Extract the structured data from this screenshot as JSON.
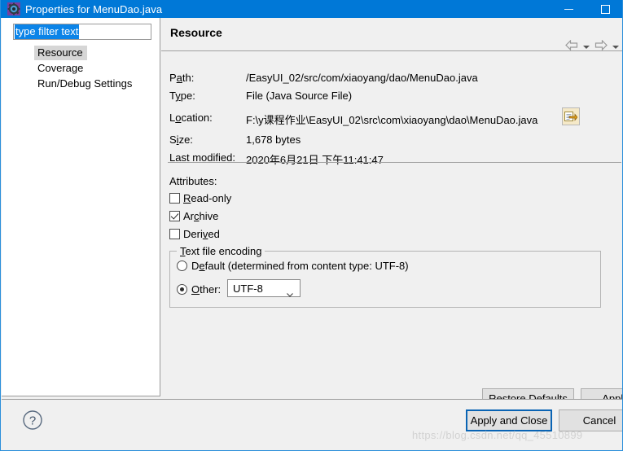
{
  "window": {
    "title": "Properties for MenuDao.java",
    "icon": "properties-gear-icon",
    "accent_color": "#0078d7",
    "minimize_label": "Minimize",
    "maximize_label": "Maximize"
  },
  "sidebar": {
    "filter": {
      "value": "type filter text",
      "placeholder": "type filter text",
      "selection_color": "#0b84e8"
    },
    "items": [
      {
        "label": "Resource",
        "selected": true
      },
      {
        "label": "Coverage",
        "selected": false
      },
      {
        "label": "Run/Debug Settings",
        "selected": false
      }
    ]
  },
  "nav": {
    "back_icon": "arrow-left-icon",
    "back_menu_icon": "chevron-down-icon",
    "forward_icon": "arrow-right-icon",
    "forward_menu_icon": "chevron-down-icon"
  },
  "page": {
    "heading": "Resource",
    "properties": [
      {
        "label_pre": "P",
        "label_mn": "a",
        "label_post": "th:",
        "value": "/EasyUI_02/src/com/xiaoyang/dao/MenuDao.java",
        "name": "path"
      },
      {
        "label_pre": "T",
        "label_mn": "y",
        "label_post": "pe:",
        "value": "File   (Java Source File)",
        "name": "type"
      },
      {
        "label_pre": "L",
        "label_mn": "o",
        "label_post": "cation:",
        "value": "F:\\y课程作业\\EasyUI_02\\src\\com\\xiaoyang\\dao\\MenuDao.java",
        "name": "location"
      },
      {
        "label_pre": "S",
        "label_mn": "i",
        "label_post": "ze:",
        "value": "1,678   bytes",
        "name": "size"
      },
      {
        "label_pre": "Last ",
        "label_mn": "m",
        "label_post": "odified:",
        "value": "2020年6月21日 下午11:41:47",
        "name": "last-modified"
      }
    ],
    "location_button_icon": "open-external-editor-icon",
    "attributes": {
      "label": "Attributes:",
      "items": [
        {
          "pre": "",
          "mn": "R",
          "post": "ead-only",
          "checked": false,
          "name": "read-only"
        },
        {
          "pre": "Ar",
          "mn": "c",
          "post": "hive",
          "checked": true,
          "name": "archive"
        },
        {
          "pre": "Deri",
          "mn": "v",
          "post": "ed",
          "checked": false,
          "name": "derived"
        }
      ]
    },
    "encoding": {
      "legend_pre": "",
      "legend_mn": "T",
      "legend_post": "ext file encoding",
      "default_option": {
        "pre": "D",
        "mn": "e",
        "post": "fault (determined from content type: UTF-8)",
        "selected": false
      },
      "other_option": {
        "pre": "",
        "mn": "O",
        "post": "ther:",
        "selected": true
      },
      "combo_value": "UTF-8",
      "combo_caret_icon": "chevron-down-icon"
    }
  },
  "buttons": {
    "restore_defaults": {
      "pre": "Restore ",
      "mn": "D",
      "post": "efaults"
    },
    "apply": {
      "pre": "",
      "mn": "A",
      "post": "pply"
    },
    "apply_and_close": "Apply and Close",
    "cancel": "Cancel",
    "help_icon": "help-question-icon",
    "focus_color": "#0a64b4"
  },
  "watermark": "https://blog.csdn.net/qq_45510899"
}
